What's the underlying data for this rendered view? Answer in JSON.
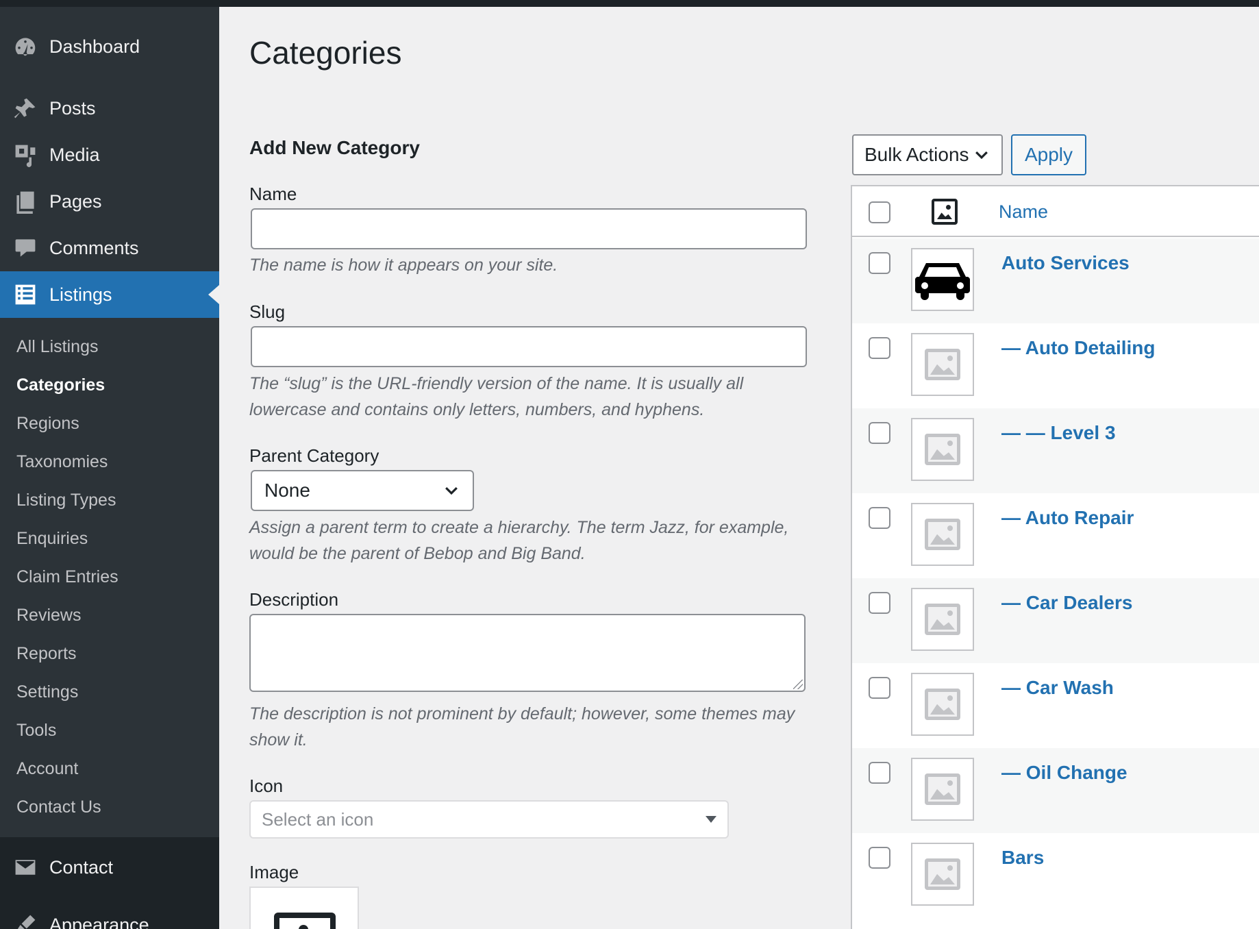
{
  "sidebar": {
    "dashboard": "Dashboard",
    "posts": "Posts",
    "media": "Media",
    "pages": "Pages",
    "comments": "Comments",
    "listings": "Listings",
    "submenu": [
      "All Listings",
      "Categories",
      "Regions",
      "Taxonomies",
      "Listing Types",
      "Enquiries",
      "Claim Entries",
      "Reviews",
      "Reports",
      "Settings",
      "Tools",
      "Account",
      "Contact Us"
    ],
    "contact": "Contact",
    "appearance": "Appearance"
  },
  "page": {
    "title": "Categories"
  },
  "form": {
    "title": "Add New Category",
    "name_label": "Name",
    "name_value": "",
    "name_help": "The name is how it appears on your site.",
    "slug_label": "Slug",
    "slug_value": "",
    "slug_help": "The “slug” is the URL-friendly version of the name. It is usually all lowercase and contains only letters, numbers, and hyphens.",
    "parent_label": "Parent Category",
    "parent_value": "None",
    "parent_help": "Assign a parent term to create a hierarchy. The term Jazz, for example, would be the parent of Bebop and Big Band.",
    "description_label": "Description",
    "description_help": "The description is not prominent by default; however, some themes may show it.",
    "icon_label": "Icon",
    "icon_placeholder": "Select an icon",
    "image_label": "Image"
  },
  "table": {
    "bulk_actions": "Bulk Actions",
    "apply": "Apply",
    "column_name": "Name",
    "rows": [
      {
        "name": "Auto Services",
        "image": "car-icon"
      },
      {
        "name": "— Auto Detailing",
        "image": "placeholder"
      },
      {
        "name": "— — Level 3",
        "image": "placeholder"
      },
      {
        "name": "— Auto Repair",
        "image": "placeholder"
      },
      {
        "name": "— Car Dealers",
        "image": "placeholder"
      },
      {
        "name": "— Car Wash",
        "image": "placeholder"
      },
      {
        "name": "— Oil Change",
        "image": "placeholder"
      },
      {
        "name": "Bars",
        "image": "placeholder"
      }
    ]
  },
  "colors": {
    "sidebar_bg": "#2c3338",
    "accent": "#2271b1",
    "page_bg": "#f0f0f1"
  }
}
